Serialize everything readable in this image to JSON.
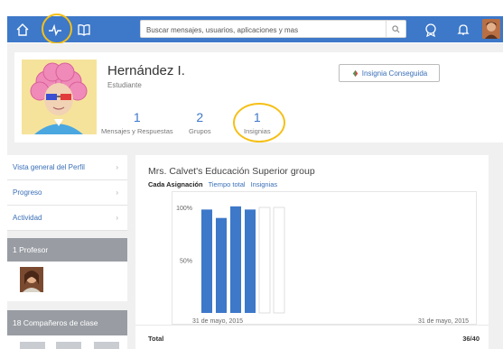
{
  "topbar": {
    "search_placeholder": "Buscar mensajes, usuarios, aplicaciones y mas",
    "icons": [
      "home-icon",
      "activity-icon",
      "book-icon",
      "search-icon",
      "badge-icon",
      "bell-icon"
    ],
    "color": "#3d78c9"
  },
  "profile": {
    "name": "Hernández I.",
    "role": "Estudiante",
    "badge_button": "Insignia Conseguida",
    "stats": [
      {
        "num": "1",
        "label": "Mensajes y Respuestas"
      },
      {
        "num": "2",
        "label": "Grupos"
      },
      {
        "num": "1",
        "label": "Insignias"
      }
    ]
  },
  "sidebar": {
    "nav": [
      "Vista general del Perfil",
      "Progreso",
      "Actividad"
    ],
    "teachers_heading": "1 Profesor",
    "classmates_heading": "18 Compañeros de clase"
  },
  "main": {
    "title": "Mrs. Calvet's Educación Superior group",
    "tabs": [
      "Cada Asignación",
      "Tiempo total",
      "Insignias"
    ],
    "total_label": "Total",
    "total_value": "36/40"
  },
  "chart_data": {
    "type": "bar",
    "y_ticks": [
      "100%",
      "50%"
    ],
    "ylim": [
      0,
      100
    ],
    "x_labels": [
      "31 de mayo, 2015",
      "31 de mayo, 2015"
    ],
    "values": [
      98,
      90,
      101,
      98,
      100,
      100
    ],
    "filled": [
      true,
      true,
      true,
      true,
      false,
      false
    ],
    "color": "#3d78c9"
  }
}
